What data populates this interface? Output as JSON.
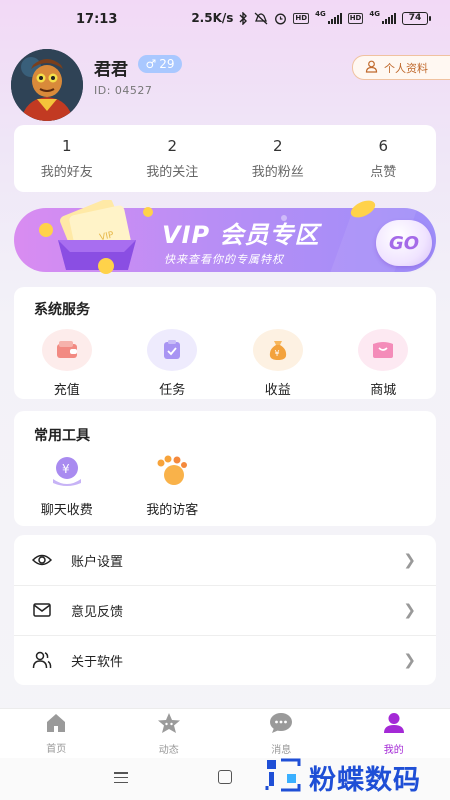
{
  "status_bar": {
    "time": "17:13",
    "net_speed": "2.5K/s",
    "hd1": "HD",
    "hd2": "HD",
    "net1": "4G",
    "net2": "4G",
    "battery": "74",
    "icons": [
      "bluetooth-icon",
      "mute-icon",
      "alarm-icon",
      "signal-icon",
      "battery-icon"
    ]
  },
  "profile": {
    "username": "君君",
    "gender_symbol": "♂",
    "level": "29",
    "user_id": "ID: 04527",
    "profile_button": "个人资料"
  },
  "stats": [
    {
      "value": "1",
      "label": "我的好友"
    },
    {
      "value": "2",
      "label": "我的关注"
    },
    {
      "value": "2",
      "label": "我的粉丝"
    },
    {
      "value": "6",
      "label": "点赞"
    }
  ],
  "vip_banner": {
    "title": "VIP 会员专区",
    "subtitle": "快来查看你的专属特权",
    "go_label": "GO"
  },
  "services": {
    "title": "系统服务",
    "items": [
      {
        "label": "充值",
        "icon": "wallet-icon"
      },
      {
        "label": "任务",
        "icon": "task-icon"
      },
      {
        "label": "收益",
        "icon": "money-bag-icon"
      },
      {
        "label": "商城",
        "icon": "shop-icon"
      }
    ]
  },
  "tools": {
    "title": "常用工具",
    "items": [
      {
        "label": "聊天收费",
        "icon": "chat-fee-icon"
      },
      {
        "label": "我的访客",
        "icon": "footprint-icon"
      }
    ]
  },
  "menu": [
    {
      "label": "账户设置",
      "icon": "eye-icon"
    },
    {
      "label": "意见反馈",
      "icon": "mail-icon"
    },
    {
      "label": "关于软件",
      "icon": "users-icon"
    }
  ],
  "bottom_nav": [
    {
      "label": "首页",
      "icon": "home-icon",
      "active": false
    },
    {
      "label": "动态",
      "icon": "star-icon",
      "active": false
    },
    {
      "label": "消息",
      "icon": "message-icon",
      "active": false
    },
    {
      "label": "我的",
      "icon": "profile-icon",
      "active": true
    }
  ],
  "watermark": "粉蝶数码",
  "colors": {
    "accent": "#a429d6",
    "vip_start": "#d98cf1",
    "vip_end": "#9e8ef9",
    "badge": "#a9c8ff"
  }
}
